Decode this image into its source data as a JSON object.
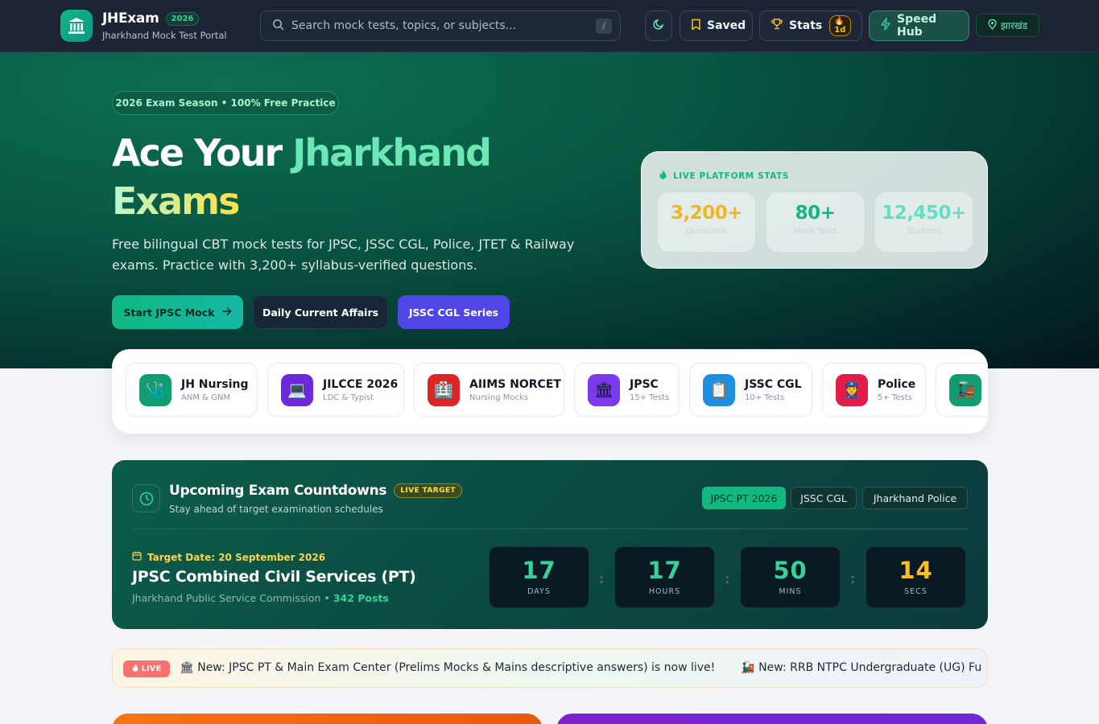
{
  "nav": {
    "brand": "JHExam",
    "year": "2026",
    "subtitle": "Jharkhand Mock Test Portal",
    "search_placeholder": "Search mock tests, topics, or subjects...",
    "search_shortcut": "/",
    "saved": "Saved",
    "stats": "Stats",
    "streak": "1d",
    "speed_hub": "Speed Hub",
    "lang": "झारखंड"
  },
  "hero": {
    "pill": "2026 Exam Season • 100% Free Practice",
    "title_white": "Ace Your ",
    "title_green": "Jharkhand",
    "title_grad": "Exams",
    "description": "Free bilingual CBT mock tests for JPSC, JSSC CGL, Police, JTET & Railway exams. Practice with 3,200+ syllabus-verified questions.",
    "cta_primary": "Start JPSC Mock",
    "cta_secondary": "Daily Current Affairs",
    "cta_tertiary": "JSSC CGL Series"
  },
  "platform_stats": {
    "title": "LIVE PLATFORM STATS",
    "items": [
      {
        "value": "3,200+",
        "label": "Questions",
        "color": "#f5b41f"
      },
      {
        "value": "80+",
        "label": "Mock Tests",
        "color": "#10b981"
      },
      {
        "value": "12,450+",
        "label": "Students",
        "color": "#5ee0c2"
      }
    ]
  },
  "categories": [
    {
      "name": "JH Nursing",
      "sub": "ANM & GNM",
      "icon": "🩺",
      "bg": "#0f9e74"
    },
    {
      "name": "JILCCE 2026",
      "sub": "LDC & Typist",
      "icon": "💻",
      "bg": "#6d28d9"
    },
    {
      "name": "AIIMS NORCET",
      "sub": "Nursing Mocks",
      "icon": "🏥",
      "bg": "#dc2626"
    },
    {
      "name": "JPSC",
      "sub": "15+ Tests",
      "icon": "🏛",
      "bg": "#7c3aed"
    },
    {
      "name": "JSSC CGL",
      "sub": "10+ Tests",
      "icon": "📋",
      "bg": "#1d8fe1"
    },
    {
      "name": "Police",
      "sub": "5+ Tests",
      "icon": "👮",
      "bg": "#e11d48"
    },
    {
      "name": "",
      "sub": "",
      "icon": "🚂",
      "bg": "#0f9e74"
    }
  ],
  "countdown": {
    "title": "Upcoming Exam Countdowns",
    "badge": "LIVE TARGET",
    "subtitle": "Stay ahead of target examination schedules",
    "tabs": [
      "JPSC PT 2026",
      "JSSC CGL",
      "Jharkhand Police"
    ],
    "target_date": "Target Date: 20 September 2026",
    "exam_name": "JPSC Combined Civil Services (PT)",
    "organization": "Jharkhand Public Service Commission",
    "separator": "•",
    "posts": "342 Posts",
    "timer": [
      {
        "value": "17",
        "label": "DAYS",
        "color": "#34d399"
      },
      {
        "value": "17",
        "label": "HOURS",
        "color": "#34d399"
      },
      {
        "value": "50",
        "label": "MINS",
        "color": "#34d399"
      },
      {
        "value": "14",
        "label": "SECS",
        "color": "#fbbf24"
      }
    ]
  },
  "ticker": {
    "live": "LIVE",
    "items": [
      "🏛 New: JPSC PT & Main Exam Center (Prelims Mocks & Mains descriptive answers) is now live!",
      "🚂 New: RRB NTPC Undergraduate (UG) Fu"
    ]
  }
}
